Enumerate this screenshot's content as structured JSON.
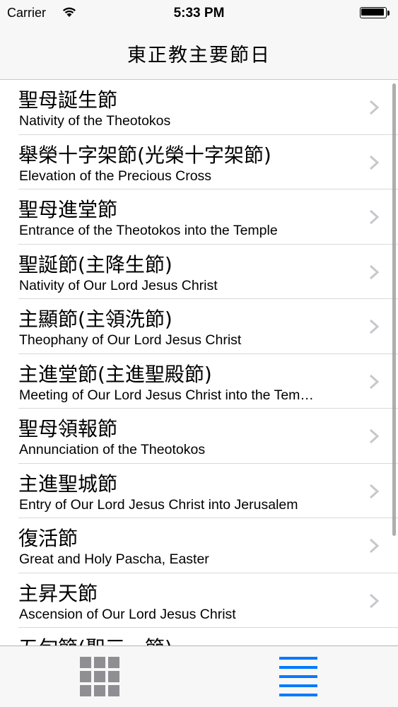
{
  "status_bar": {
    "carrier": "Carrier",
    "time": "5:33 PM",
    "wifi_icon": "wifi-icon",
    "battery_icon": "battery-icon"
  },
  "nav": {
    "title": "東正教主要節日"
  },
  "list": {
    "items": [
      {
        "title": "聖母誕生節",
        "subtitle": "Nativity of the Theotokos"
      },
      {
        "title": "舉榮十字架節(光榮十字架節)",
        "subtitle": "Elevation of the Precious Cross"
      },
      {
        "title": "聖母進堂節",
        "subtitle": "Entrance of the Theotokos into the Temple"
      },
      {
        "title": "聖誕節(主降生節)",
        "subtitle": "Nativity of Our Lord Jesus Christ"
      },
      {
        "title": "主顯節(主領洗節)",
        "subtitle": "Theophany of Our Lord Jesus Christ"
      },
      {
        "title": "主進堂節(主進聖殿節)",
        "subtitle": "Meeting of Our Lord Jesus Christ into the Tem…"
      },
      {
        "title": "聖母領報節",
        "subtitle": "Annunciation of the Theotokos"
      },
      {
        "title": "主進聖城節",
        "subtitle": "Entry of Our Lord Jesus Christ into Jerusalem"
      },
      {
        "title": "復活節",
        "subtitle": "Great and Holy Pascha, Easter"
      },
      {
        "title": "主昇天節",
        "subtitle": "Ascension of Our Lord Jesus Christ"
      },
      {
        "title": "五旬節(聖三一節)",
        "subtitle": ""
      }
    ],
    "chevron_icon": "chevron-right-icon"
  },
  "tab_bar": {
    "tabs": [
      {
        "icon": "grid-icon",
        "selected": false,
        "color": "#8e8e93"
      },
      {
        "icon": "list-icon",
        "selected": true,
        "color": "#007aff"
      }
    ]
  }
}
